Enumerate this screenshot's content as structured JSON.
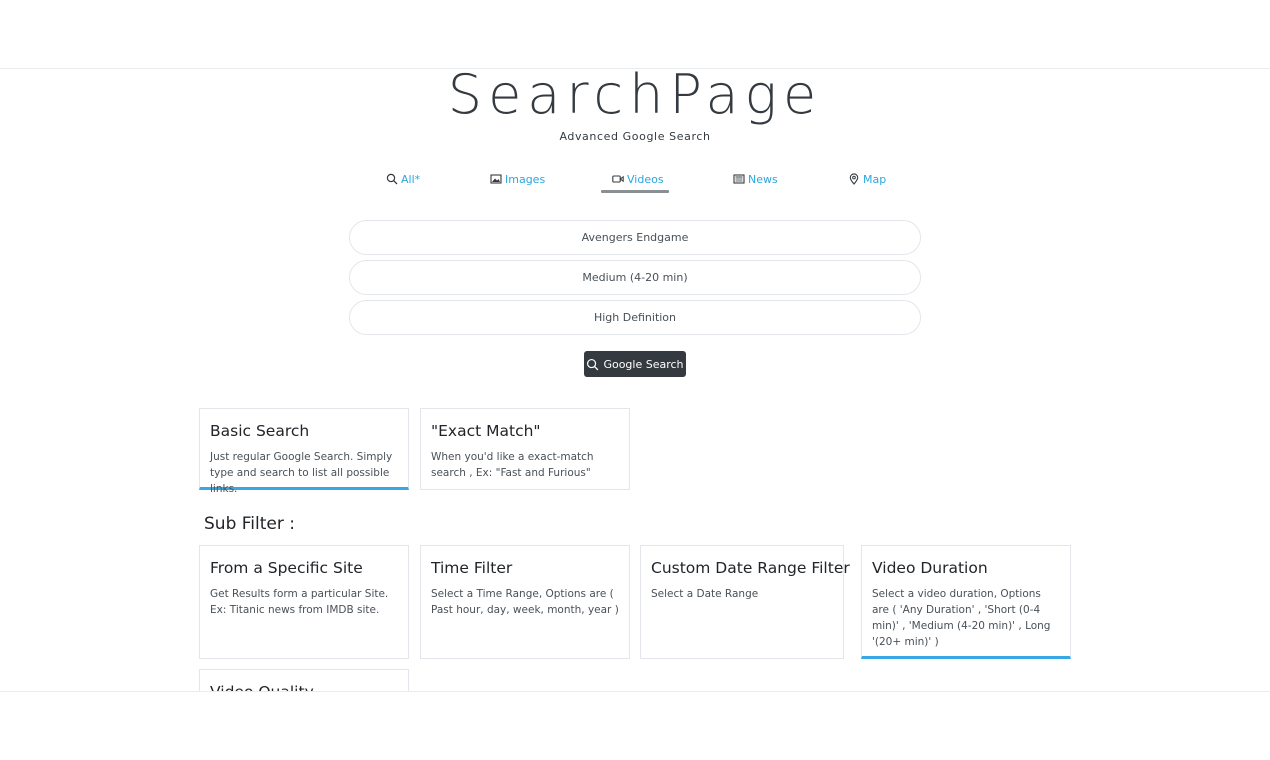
{
  "brand": {
    "title": "SearchPage",
    "tagline": "Advanced Google Search"
  },
  "tabs": [
    {
      "label": "All*",
      "icon": "search-icon"
    },
    {
      "label": "Images",
      "icon": "image-icon"
    },
    {
      "label": "Videos",
      "icon": "video-icon",
      "active": true
    },
    {
      "label": "News",
      "icon": "newspaper-icon"
    },
    {
      "label": "Map",
      "icon": "map-pin-icon"
    }
  ],
  "form": {
    "query": "Avengers Endgame",
    "duration": "Medium (4-20 min)",
    "quality": "High Definition",
    "submit_label": "Google Search"
  },
  "cards": {
    "basic": {
      "title": "Basic Search",
      "text": "Just regular Google Search. Simply type and search to list all possible links."
    },
    "exact": {
      "title": "\"Exact Match\"",
      "text": "When you'd like a exact-match search , Ex: \"Fast and Furious\""
    }
  },
  "sub_filter": {
    "heading": "Sub Filter :",
    "cards": [
      {
        "title": "From a Specific Site",
        "text": "Get Results form a particular Site. Ex: Titanic news from IMDB site."
      },
      {
        "title": "Time Filter",
        "text": "Select a Time Range, Options are ( Past hour, day, week, month, year )"
      },
      {
        "title": "Custom Date Range Filter",
        "text": "Select a Date Range"
      },
      {
        "title": "Video Duration",
        "text": "Select a video duration, Options are ( 'Any Duration' , 'Short (0-4 min)' , 'Medium (4-20 min)' , Long '(20+ min)' )"
      },
      {
        "title": "Video Quality",
        "text": ""
      }
    ]
  },
  "colors": {
    "accent": "#2aa7e0",
    "active_border": "#37a8e6",
    "dark": "#343a40"
  }
}
